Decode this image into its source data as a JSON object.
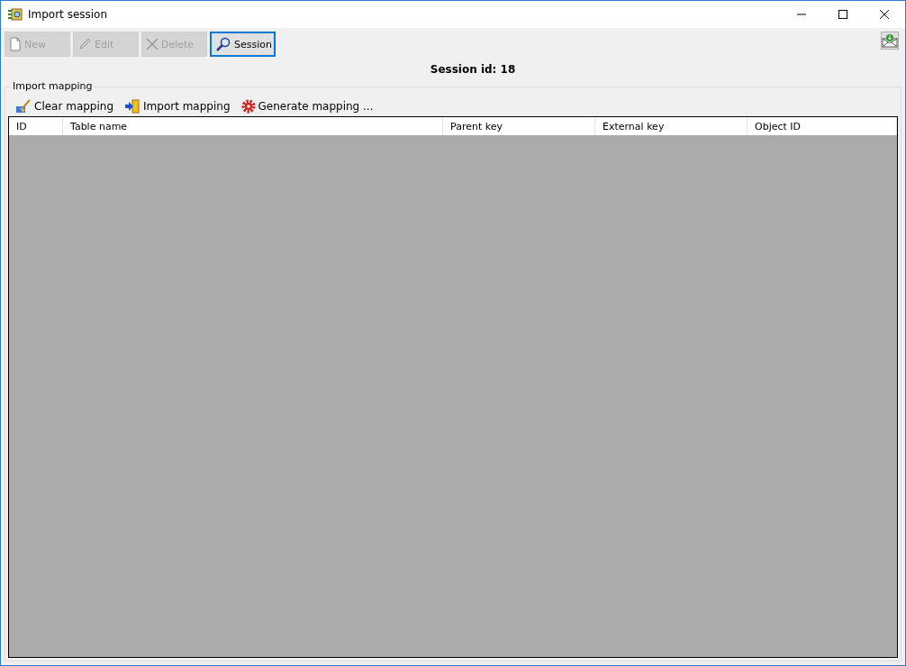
{
  "window": {
    "title": "Import session"
  },
  "toolbar": [
    {
      "label": "New",
      "kind": "new",
      "disabled": true,
      "selected": false
    },
    {
      "label": "Edit",
      "kind": "edit",
      "disabled": true,
      "selected": false
    },
    {
      "label": "Delete",
      "kind": "delete",
      "disabled": true,
      "selected": false
    },
    {
      "label": "Session",
      "kind": "session",
      "disabled": false,
      "selected": true
    }
  ],
  "session_label": "Session id:  18",
  "group": {
    "title": "Import mapping",
    "actions": [
      {
        "label": "Clear mapping",
        "kind": "clear"
      },
      {
        "label": "Import mapping",
        "kind": "import"
      },
      {
        "label": "Generate mapping ...",
        "kind": "generate"
      }
    ],
    "table": {
      "columns": [
        "ID",
        "Table name",
        "Parent key",
        "External key",
        "Object ID"
      ]
    }
  }
}
